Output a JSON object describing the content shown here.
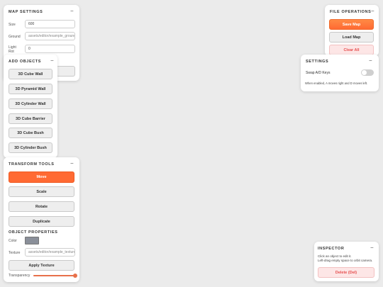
{
  "map_settings": {
    "title": "MAP SETTINGS",
    "collapse": "−",
    "size_label": "Size",
    "size_value": "600",
    "ground_label": "Ground",
    "ground_value": "assets/editor/example_ground",
    "light_label": "Light Rot",
    "light_value": "0"
  },
  "add_objects": {
    "title": "ADD OBJECTS",
    "collapse": "−",
    "buttons": [
      "3D Cube Wall",
      "3D Pyramid Wall",
      "3D Cylinder Wall",
      "3D Cube Barrier",
      "3D Cube Bush",
      "3D Cylinder Bush"
    ]
  },
  "transform_tools": {
    "title": "TRANSFORM TOOLS",
    "collapse": "−",
    "move": "Move",
    "scale": "Scale",
    "rotate": "Rotate",
    "duplicate": "Duplicate"
  },
  "object_properties": {
    "title": "OBJECT PROPERTIES",
    "color_label": "Color",
    "color_value": "#8a8f99",
    "texture_label": "Texture",
    "texture_value": "assets/editor/example_texture",
    "apply_texture": "Apply Texture",
    "transparency_label": "Transparency",
    "transparency_value": 1.0
  },
  "file_operations": {
    "title": "FILE OPERATIONS",
    "collapse": "−",
    "save": "Save Map",
    "load": "Load Map",
    "clear": "Clear All"
  },
  "settings": {
    "title": "SETTINGS",
    "collapse": "−",
    "swap_label": "Swap A/D Keys",
    "swap_on": false,
    "description": "When enabled, A moves right and D moves left."
  },
  "inspector": {
    "title": "INSPECTOR",
    "collapse": "−",
    "line1": "Click an object to edit it.",
    "line2": "Left-drag empty space to orbit camera.",
    "delete": "Delete (Del)"
  },
  "colors": {
    "accent": "#ff6a33",
    "danger": "#e65050",
    "background": "#ebebeb"
  }
}
